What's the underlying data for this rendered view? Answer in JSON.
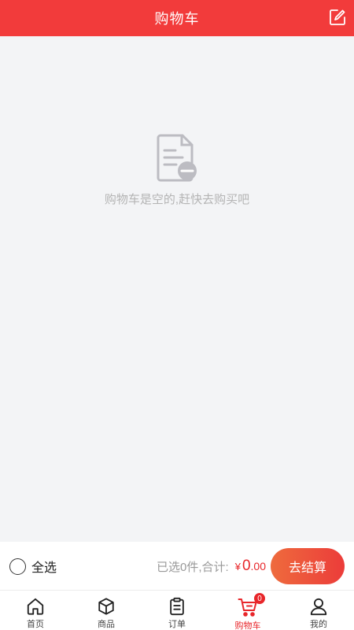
{
  "header": {
    "title": "购物车",
    "edit_icon": "edit-icon",
    "background": "#f23b3b"
  },
  "empty_state": {
    "icon": "document-minus-icon",
    "message": "购物车是空的,赶快去购买吧"
  },
  "checkout_bar": {
    "select_all_label": "全选",
    "summary_text": "已选0件,合计:",
    "currency_symbol": "¥",
    "price_integer": "0",
    "price_decimal": ".00",
    "checkout_button_label": "去结算",
    "accent_color": "#e8262a"
  },
  "tabbar": {
    "tabs": [
      {
        "label": "首页",
        "icon": "home-icon"
      },
      {
        "label": "商品",
        "icon": "box-icon"
      },
      {
        "label": "订单",
        "icon": "clipboard-icon"
      },
      {
        "label": "购物车",
        "icon": "cart-icon",
        "active": true,
        "badge": "0"
      },
      {
        "label": "我的",
        "icon": "user-icon"
      }
    ]
  }
}
